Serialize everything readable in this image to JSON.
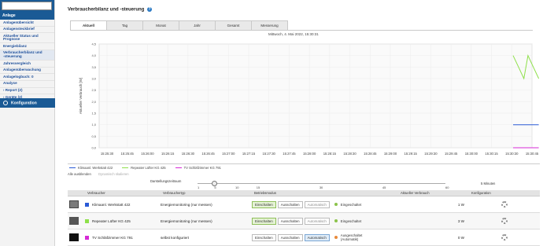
{
  "sidebar": {
    "search_placeholder": "",
    "header": "Anlage",
    "items": [
      {
        "label": "Anlagenübersicht",
        "active": false
      },
      {
        "label": "Anlagensteckbrief",
        "active": false
      },
      {
        "label": "Aktueller Status und\nPrognose",
        "active": false
      },
      {
        "label": "Energiebilanz",
        "active": false
      },
      {
        "label": "Verbraucherbilanz und\n-steuerung",
        "active": true
      },
      {
        "label": "Jahresvergleich",
        "active": false
      },
      {
        "label": "Anlagenüberwachung",
        "active": false
      },
      {
        "label": "Anlagelogbuch: 0",
        "active": false
      },
      {
        "label": "Analyse",
        "active": false
      },
      {
        "label": "› Report (2)",
        "active": false
      },
      {
        "label": "› Geräte (2)",
        "active": false
      }
    ],
    "config_label": "Konfiguration"
  },
  "page": {
    "title": "Verbraucherbilanz und -steuerung",
    "help_icon": "?",
    "tabs": [
      "Aktuell",
      "Tag",
      "Monat",
      "Jahr",
      "Gesamt",
      "Messerung"
    ],
    "active_tab": "Aktuell",
    "timestamp": "Mittwoch, 4. Mai 2022, 15:30:31"
  },
  "chart_data": {
    "type": "line",
    "ylabel": "Aktueller Verbrauch [W]",
    "ylim": [
      0,
      4.5
    ],
    "yticks": [
      "4,5",
      "4,0",
      "3,5",
      "3,0",
      "2,5",
      "2,0",
      "1,5",
      "1,0",
      "0,5",
      "0,0"
    ],
    "x_ticks": [
      "15:25:30",
      "15:25:45",
      "15:26:00",
      "15:26:15",
      "15:26:30",
      "15:26:45",
      "15:27:00",
      "15:27:15",
      "15:27:30",
      "15:27:45",
      "15:28:00",
      "15:28:15",
      "15:28:30",
      "15:28:45",
      "15:29:00",
      "15:29:15",
      "15:29:30",
      "15:29:45",
      "15:30:00",
      "15:30:15",
      "15:30:30",
      "15:30:45"
    ],
    "grid": true,
    "series": [
      {
        "name": "Klimaanl. Werkstatt 422",
        "color": "#2a5ad6",
        "x": [
          "15:30:31",
          "15:30:45",
          "15:30:50"
        ],
        "values": [
          1,
          1,
          1
        ]
      },
      {
        "name": "Repeater Lüfter KG 425",
        "color": "#8ee04a",
        "x": [
          "15:30:31",
          "15:30:35",
          "15:30:39",
          "15:30:42",
          "15:30:46",
          "15:30:50"
        ],
        "values": [
          4.0,
          3.5,
          3.0,
          4.0,
          3.5,
          3.0
        ]
      },
      {
        "name": "TV Schläfzimmer KG 791",
        "color": "#d62ad6",
        "x": [
          "15:30:31",
          "15:30:45",
          "15:30:50"
        ],
        "values": [
          0,
          0,
          0
        ]
      }
    ],
    "controls": {
      "hide_all": "Alle ausblenden",
      "dynamic_scale": "Dynamisch skalieren"
    }
  },
  "interval": {
    "label": "Darstellungszeitraum",
    "ticks": [
      "1",
      "5",
      "10",
      "15",
      "30",
      "45",
      "60"
    ],
    "value": 5,
    "unit": "5 Minuten"
  },
  "table": {
    "headers": [
      "",
      "Verbraucher",
      "Verbrauchertyp",
      "Betriebsmodus",
      "Aktueller Verbrauch",
      "Konfiguration"
    ],
    "rows": [
      {
        "name": "Klimaanl. Werkstatt 422",
        "color": "#2a5ad6",
        "thumb": "cam",
        "type": "Energiemonitoring (nur messen)",
        "modes": [
          "Einschalten",
          "Ausschalten",
          "Automatisch"
        ],
        "selected_mode": "Einschalten",
        "status": "Eingeschaltet",
        "status_color": "#8bc34a",
        "consumption": "1 W"
      },
      {
        "name": "Repeater Lüfter KG 425",
        "color": "#8ee04a",
        "thumb": "dev",
        "type": "Energiemonitoring (nur messen)",
        "modes": [
          "Einschalten",
          "Ausschalten",
          "Automatisch"
        ],
        "selected_mode": "Einschalten",
        "status": "Eingeschaltet",
        "status_color": "#8bc34a",
        "consumption": "3 W"
      },
      {
        "name": "TV Schläfzimmer KG 791",
        "color": "#d62ad6",
        "thumb": "tv",
        "type": "selbst konfiguriert",
        "modes": [
          "Einschalten",
          "Ausschalten",
          "Automatisch"
        ],
        "selected_mode": "Automatisch",
        "status": "Ausgeschaltet\n(Automatik)",
        "status_color": "#e88a3a",
        "consumption": "0 W"
      }
    ]
  }
}
